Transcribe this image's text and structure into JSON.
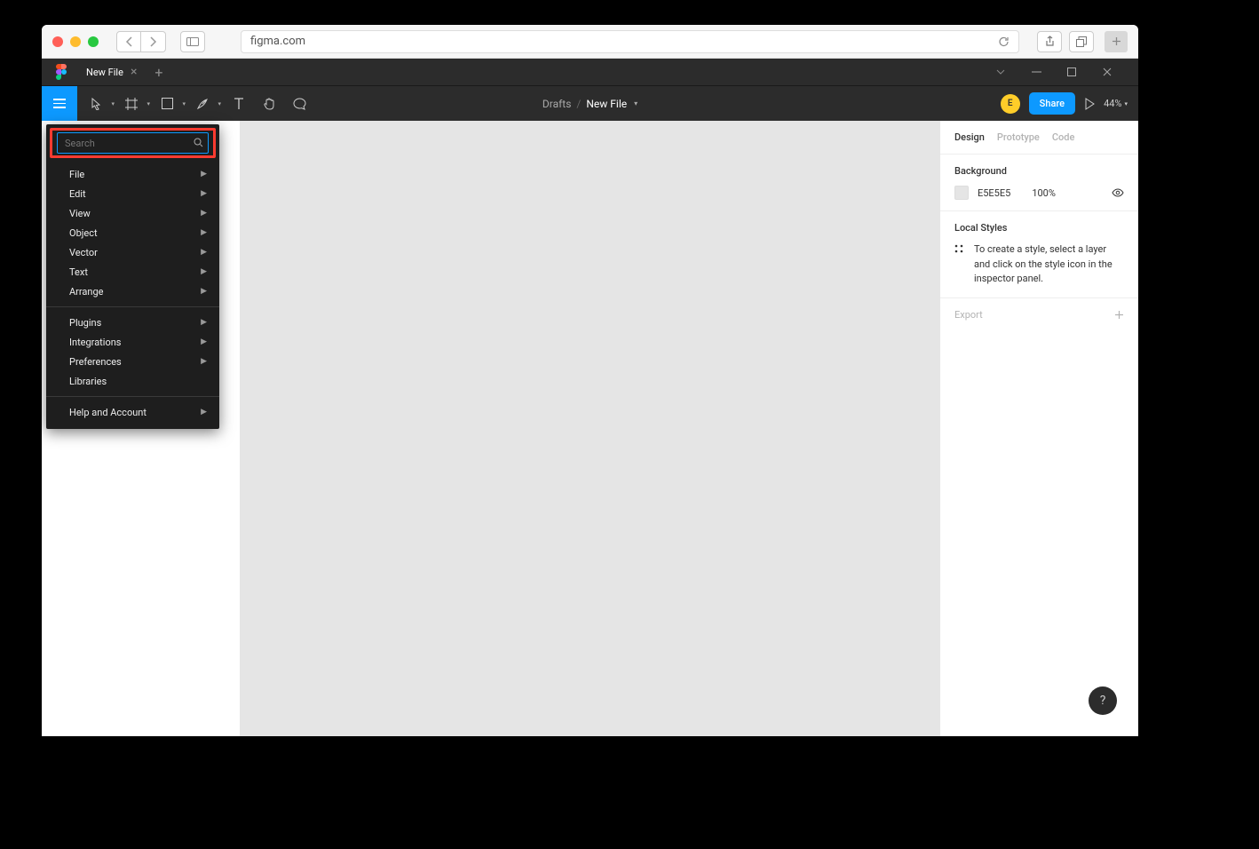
{
  "browser": {
    "url": "figma.com"
  },
  "tabs": {
    "active": "New File"
  },
  "toolbar": {
    "breadcrumb_parent": "Drafts",
    "breadcrumb_current": "New File",
    "avatar_letter": "E",
    "share": "Share",
    "zoom": "44%"
  },
  "menu": {
    "search_placeholder": "Search",
    "items1": [
      "File",
      "Edit",
      "View",
      "Object",
      "Vector",
      "Text",
      "Arrange"
    ],
    "items2": [
      "Plugins",
      "Integrations",
      "Preferences",
      "Libraries"
    ],
    "items3": [
      "Help and Account"
    ],
    "no_arrow_items": [
      "Libraries"
    ]
  },
  "right_panel": {
    "tabs": [
      "Design",
      "Prototype",
      "Code"
    ],
    "active_tab": "Design",
    "background": {
      "title": "Background",
      "hex": "E5E5E5",
      "opacity": "100%"
    },
    "local_styles": {
      "title": "Local Styles",
      "text": "To create a style, select a layer and click on the style icon in the inspector panel."
    },
    "export": "Export"
  },
  "help": "?"
}
